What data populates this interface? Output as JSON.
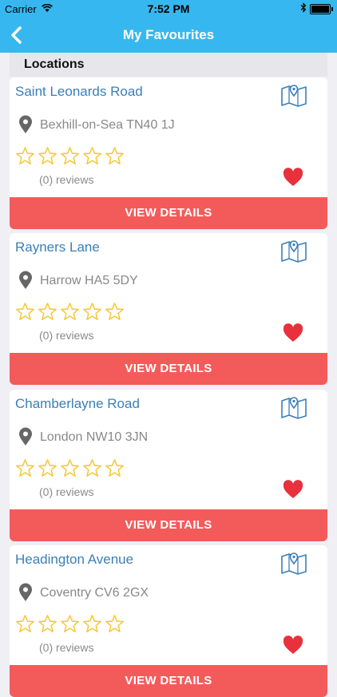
{
  "status": {
    "carrier": "Carrier",
    "time": "7:52 PM"
  },
  "nav": {
    "title": "My Favourites"
  },
  "section": {
    "title": "Locations"
  },
  "cards": [
    {
      "name": "Saint Leonards Road",
      "address": "Bexhill-on-Sea TN40 1J",
      "reviews": "(0) reviews",
      "button": "VIEW DETAILS"
    },
    {
      "name": "Rayners Lane",
      "address": "Harrow HA5 5DY",
      "reviews": "(0) reviews",
      "button": "VIEW DETAILS"
    },
    {
      "name": "Chamberlayne Road",
      "address": "London NW10 3JN",
      "reviews": "(0) reviews",
      "button": "VIEW DETAILS"
    },
    {
      "name": "Headington Avenue",
      "address": "Coventry CV6 2GX",
      "reviews": "(0) reviews",
      "button": "VIEW DETAILS"
    }
  ],
  "colors": {
    "bar": "#37b7ef",
    "link": "#3a7fb8",
    "button": "#f35b5b",
    "star": "#f5c93b",
    "heart": "#e8313c"
  }
}
